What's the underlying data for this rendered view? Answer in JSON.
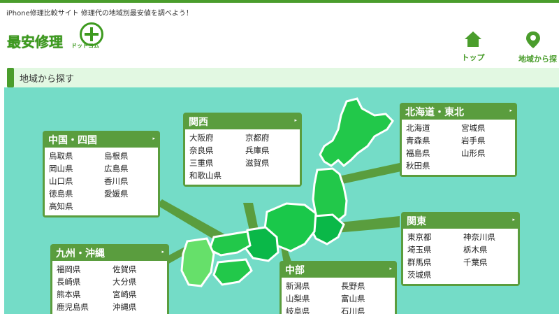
{
  "header": {
    "tagline": "iPhone修理比較サイト 修理代の地域別最安値を調べよう！",
    "logo_main": "最安修理",
    "logo_sub": "ドットコム"
  },
  "nav": {
    "top_label": "トップ",
    "area_label": "地域から探"
  },
  "section": {
    "title": "地域から探す"
  },
  "regions": {
    "chugoku": {
      "name": "中国・四国",
      "prefs": [
        "鳥取県",
        "島根県",
        "岡山県",
        "広島県",
        "山口県",
        "香川県",
        "徳島県",
        "愛媛県",
        "高知県"
      ]
    },
    "kansai": {
      "name": "関西",
      "prefs": [
        "大阪府",
        "京都府",
        "奈良県",
        "兵庫県",
        "三重県",
        "滋賀県",
        "和歌山県"
      ]
    },
    "hokkaido": {
      "name": "北海道・東北",
      "prefs": [
        "北海道",
        "宮城県",
        "青森県",
        "岩手県",
        "福島県",
        "山形県",
        "秋田県"
      ]
    },
    "kanto": {
      "name": "関東",
      "prefs": [
        "東京都",
        "神奈川県",
        "埼玉県",
        "栃木県",
        "群馬県",
        "千葉県",
        "茨城県"
      ]
    },
    "kyushu": {
      "name": "九州・沖縄",
      "prefs": [
        "福岡県",
        "佐賀県",
        "長崎県",
        "大分県",
        "熊本県",
        "宮崎県",
        "鹿児島県",
        "沖縄県"
      ]
    },
    "chubu": {
      "name": "中部",
      "prefs": [
        "新潟県",
        "長野県",
        "山梨県",
        "富山県",
        "岐阜県",
        "石川県"
      ]
    }
  },
  "icons": {
    "arrow": "▸"
  },
  "colors": {
    "brand_green": "#4a9d2c",
    "map_bg": "#74dcc7",
    "land": "#22c84a"
  }
}
